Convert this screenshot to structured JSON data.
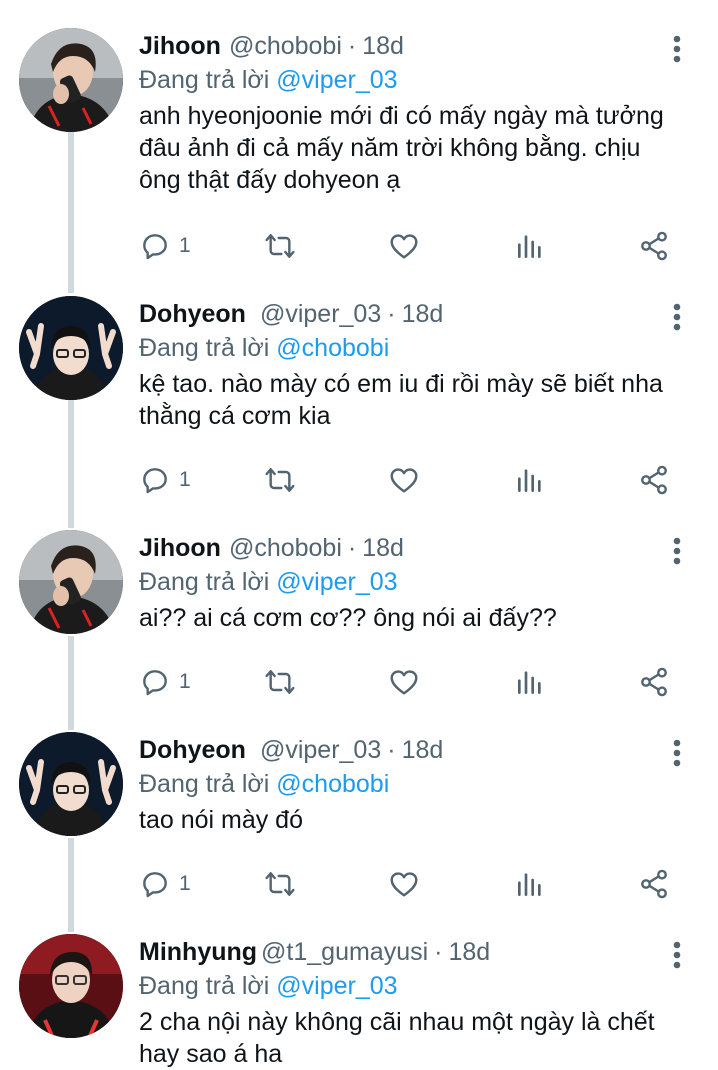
{
  "colors": {
    "accent": "#1d9bf0",
    "secondary_text": "#536471",
    "primary_text": "#0f1419",
    "thread_line": "#cfd9de"
  },
  "icons": {
    "more": "vertical-dots-icon",
    "reply": "speech-bubble-icon",
    "retweet": "retweet-arrows-icon",
    "like": "heart-icon",
    "views": "bar-chart-icon",
    "share": "share-nodes-icon"
  },
  "tweets": [
    {
      "name": "Jihoon",
      "handle": "@chobobi",
      "dot": "·",
      "time": "18d",
      "reply_prefix": "Đang trả lời",
      "reply_handle": "@viper_03",
      "text": "anh hyeonjoonie mới đi có mấy ngày mà tưởng đâu ảnh đi cả mấy năm trời không bằng. chịu ông thật đấy dohyeon ạ",
      "reply_count": "1"
    },
    {
      "name": "Dohyeon",
      "handle": "@viper_03",
      "dot": "·",
      "time": "18d",
      "reply_prefix": "Đang trả lời",
      "reply_handle": "@chobobi",
      "text": "kệ tao. nào mày có em iu đi rồi mày sẽ biết nha thằng cá cơm kia",
      "reply_count": "1"
    },
    {
      "name": "Jihoon",
      "handle": "@chobobi",
      "dot": "·",
      "time": "18d",
      "reply_prefix": "Đang trả lời",
      "reply_handle": "@viper_03",
      "text": "ai?? ai cá cơm cơ?? ông nói ai đấy??",
      "reply_count": "1"
    },
    {
      "name": "Dohyeon",
      "handle": "@viper_03",
      "dot": "·",
      "time": "18d",
      "reply_prefix": "Đang trả lời",
      "reply_handle": "@chobobi",
      "text": "tao nói mày đó",
      "reply_count": "1"
    },
    {
      "name": "Minhyung",
      "handle": "@t1_gumayusi",
      "dot": "·",
      "time": "18d",
      "reply_prefix": "Đang trả lời",
      "reply_handle": "@viper_03",
      "text": "2 cha nội này không cãi nhau một ngày là chết hay sao á ha"
    }
  ]
}
